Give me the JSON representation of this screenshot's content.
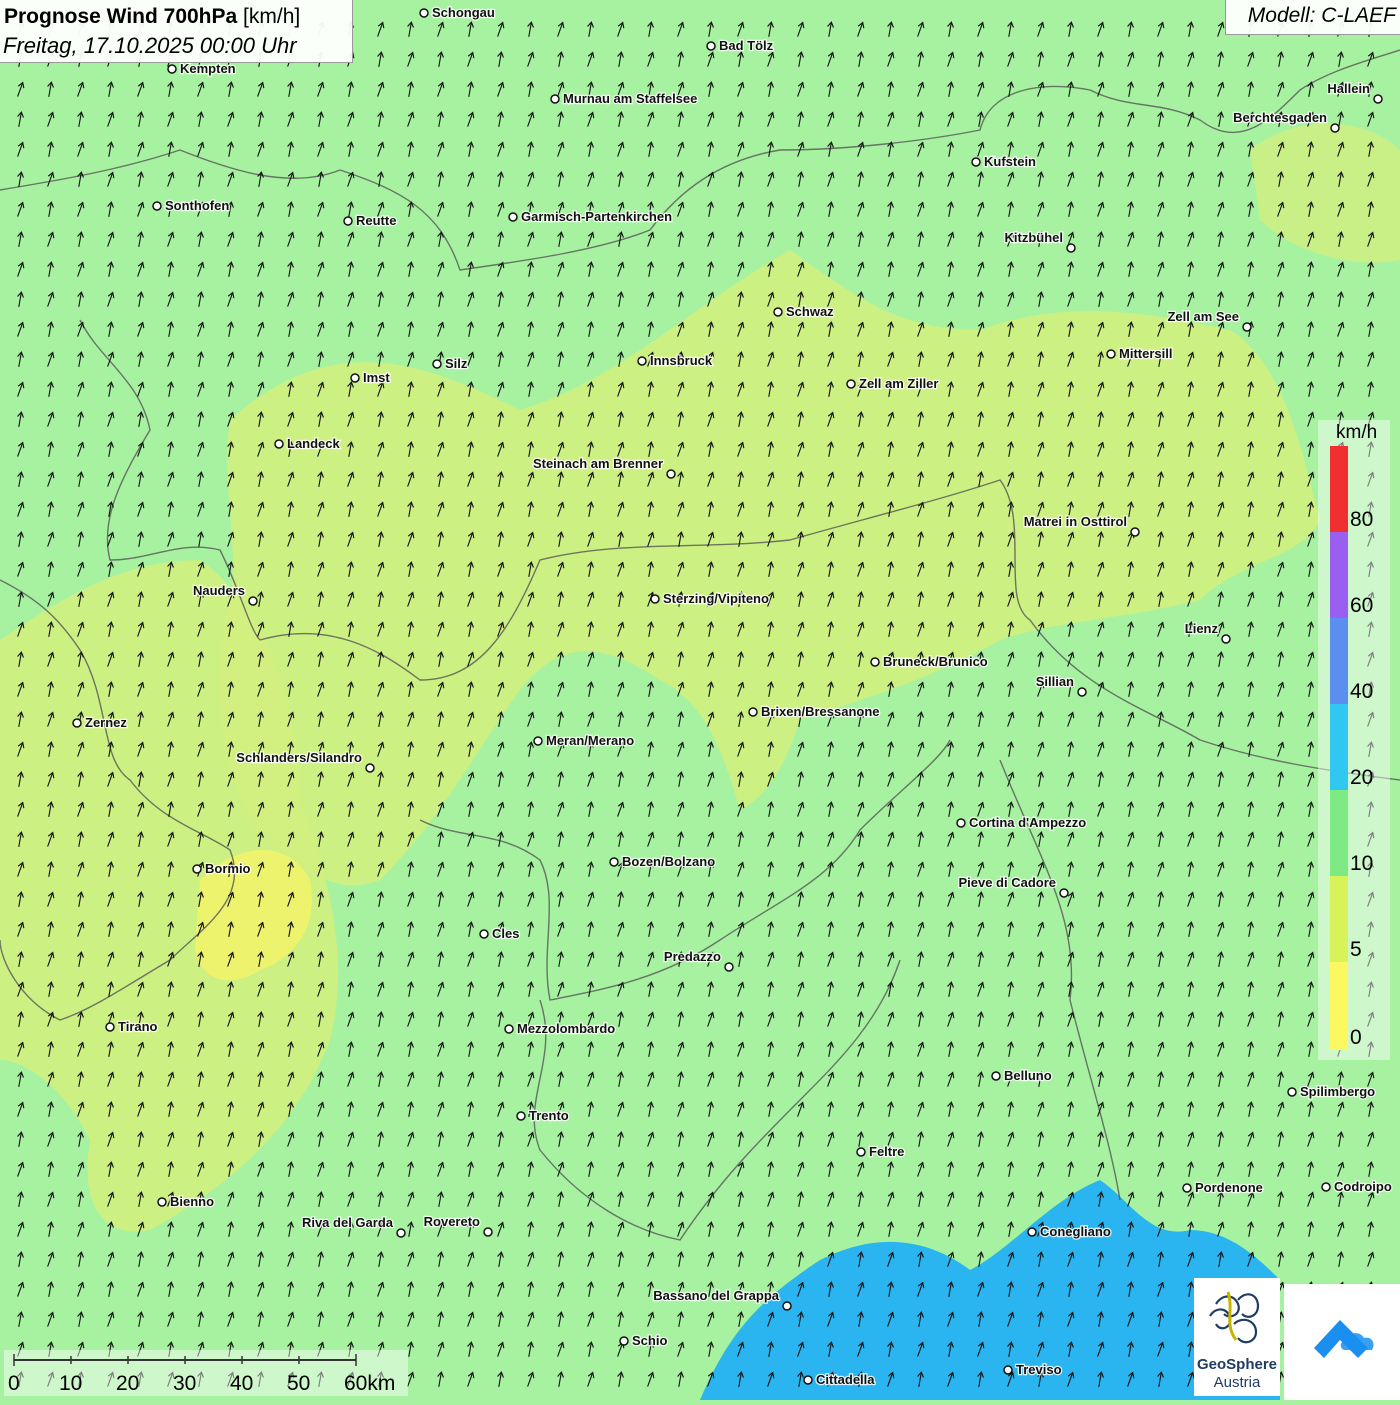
{
  "header": {
    "title": "Prognose Wind 700hPa",
    "unit": "[km/h]",
    "datetime": "Freitag, 17.10.2025 00:00 Uhr"
  },
  "model": {
    "label": "Modell: C-LAEF"
  },
  "legend": {
    "unit": "km/h",
    "ticks": [
      "80",
      "60",
      "40",
      "20",
      "10",
      "5",
      "0"
    ],
    "colors": [
      "#f03030",
      "#9a5ff0",
      "#5a8ff0",
      "#30c8f0",
      "#7eea84",
      "#d6f35a",
      "#fbf862"
    ]
  },
  "scale_bar": {
    "labels": [
      "0",
      "10",
      "20",
      "30",
      "40",
      "50",
      "60km"
    ]
  },
  "colors": {
    "background": "#a6f2a0",
    "yellow_green": "#d2ef80",
    "lagoon": "#2ab5f0",
    "border": "#555555"
  },
  "cities": [
    {
      "name": "Schongau"
    },
    {
      "name": "Bad Tölz"
    },
    {
      "name": "Kempten"
    },
    {
      "name": "Murnau am Staffelsee"
    },
    {
      "name": "Hallein"
    },
    {
      "name": "Berchtesgaden"
    },
    {
      "name": "Kufstein"
    },
    {
      "name": "Sonthofen"
    },
    {
      "name": "Reutte"
    },
    {
      "name": "Garmisch-Partenkirchen"
    },
    {
      "name": "Kitzbühel"
    },
    {
      "name": "Schwaz"
    },
    {
      "name": "Zell am See"
    },
    {
      "name": "Mittersill"
    },
    {
      "name": "Silz"
    },
    {
      "name": "Innsbruck"
    },
    {
      "name": "Imst"
    },
    {
      "name": "Zell am Ziller"
    },
    {
      "name": "Landeck"
    },
    {
      "name": "Steinach am Brenner"
    },
    {
      "name": "Matrei in Osttirol"
    },
    {
      "name": "Nauders"
    },
    {
      "name": "Sterzing/Vipiteno"
    },
    {
      "name": "Lienz"
    },
    {
      "name": "Bruneck/Brunico"
    },
    {
      "name": "Sillian"
    },
    {
      "name": "Zernez"
    },
    {
      "name": "Brixen/Bressanone"
    },
    {
      "name": "Meran/Merano"
    },
    {
      "name": "Schlanders/Silandro"
    },
    {
      "name": "Cortina d'Ampezzo"
    },
    {
      "name": "Bozen/Bolzano"
    },
    {
      "name": "Bormio"
    },
    {
      "name": "Pieve di Cadore"
    },
    {
      "name": "Cles"
    },
    {
      "name": "Predazzo"
    },
    {
      "name": "Tirano"
    },
    {
      "name": "Mezzolombardo"
    },
    {
      "name": "Belluno"
    },
    {
      "name": "Spilimbergo"
    },
    {
      "name": "Trento"
    },
    {
      "name": "Feltre"
    },
    {
      "name": "Pordenone"
    },
    {
      "name": "Codroipo"
    },
    {
      "name": "Bienno"
    },
    {
      "name": "Riva del Garda"
    },
    {
      "name": "Rovereto"
    },
    {
      "name": "Conegliano"
    },
    {
      "name": "Bassano del Grappa"
    },
    {
      "name": "Schio"
    },
    {
      "name": "Treviso"
    },
    {
      "name": "Cittadella"
    }
  ],
  "logos": {
    "geosphere_line1": "GeoSphere",
    "geosphere_line2": "Austria"
  }
}
